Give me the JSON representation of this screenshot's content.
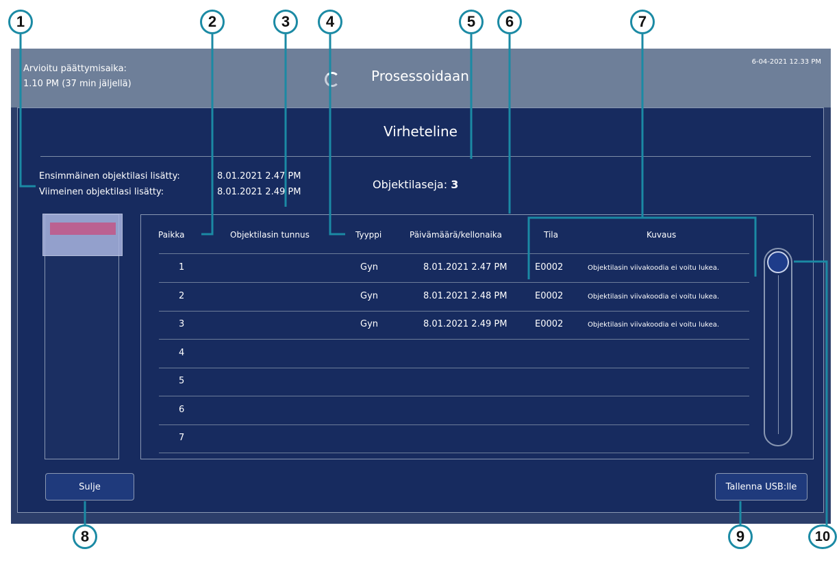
{
  "header": {
    "eta_label": "Arvioitu päättymisaika:",
    "eta_value": "1.10 PM (37 min jäljellä)",
    "status": "Prosessoidaan",
    "datetime": "6-04-2021 12.33 PM"
  },
  "dialog": {
    "title": "Virheteline",
    "first_label": "Ensimmäinen objektilasi lisätty:",
    "first_value": "8.01.2021 2.47 PM",
    "last_label": "Viimeinen objektilasi lisätty:",
    "last_value": "8.01.2021 2.49 PM",
    "count_label": "Objektilaseja:",
    "count_value": "3"
  },
  "table": {
    "headers": [
      "Paikka",
      "Objektilasin tunnus",
      "Tyyppi",
      "Päivämäärä/kellonaika",
      "Tila",
      "Kuvaus"
    ],
    "rows": [
      {
        "slot": "1",
        "id": "",
        "type": "Gyn",
        "datetime": "8.01.2021 2.47 PM",
        "status": "E0002",
        "desc": "Objektilasin viivakoodia ei voitu lukea."
      },
      {
        "slot": "2",
        "id": "",
        "type": "Gyn",
        "datetime": "8.01.2021 2.48 PM",
        "status": "E0002",
        "desc": "Objektilasin viivakoodia ei voitu lukea."
      },
      {
        "slot": "3",
        "id": "",
        "type": "Gyn",
        "datetime": "8.01.2021 2.49 PM",
        "status": "E0002",
        "desc": "Objektilasin viivakoodia ei voitu lukea."
      },
      {
        "slot": "4",
        "id": "",
        "type": "",
        "datetime": "",
        "status": "",
        "desc": ""
      },
      {
        "slot": "5",
        "id": "",
        "type": "",
        "datetime": "",
        "status": "",
        "desc": ""
      },
      {
        "slot": "6",
        "id": "",
        "type": "",
        "datetime": "",
        "status": "",
        "desc": ""
      },
      {
        "slot": "7",
        "id": "",
        "type": "",
        "datetime": "",
        "status": "",
        "desc": ""
      }
    ]
  },
  "buttons": {
    "close": "Sulje",
    "save_usb": "Tallenna USB:lle"
  },
  "callouts": [
    "1",
    "2",
    "3",
    "4",
    "5",
    "6",
    "7",
    "8",
    "9",
    "10"
  ],
  "colors": {
    "callout_border": "#1b8aa4",
    "dialog_bg": "#172b5f",
    "topbar_bg": "#6e7f99",
    "error_marker": "#d86a9a"
  }
}
